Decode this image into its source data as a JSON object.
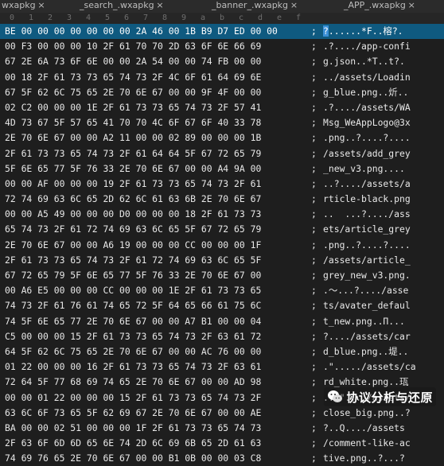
{
  "tabs": [
    {
      "label": "wxapkg",
      "close": "×"
    },
    {
      "label": "_search_.wxapkg",
      "close": "×"
    },
    {
      "label": "_banner_.wxapkg",
      "close": "×"
    },
    {
      "label": "_APP_.wxapkg",
      "close": "×"
    }
  ],
  "column_header": [
    "0",
    "1",
    "2",
    "3",
    "4",
    "5",
    "6",
    "7",
    "8",
    "9",
    "a",
    "b",
    "c",
    "d",
    "e",
    "f"
  ],
  "rows": [
    {
      "hex": "BE 00 00 00 00 00 00 00 2A 46 00 1B B9 D7 ED 00 00",
      "sep": ";",
      "text_caret": "?",
      "text_rest": "......*F..榕?."
    },
    {
      "hex": "00 F3 00 00 00 10 2F 61 70 70 2D 63 6F 6E 66 69",
      "sep": ";",
      "text": ".?..../app-confi"
    },
    {
      "hex": "67 2E 6A 73 6F 6E 00 00 2A 54 00 00 74 FB 00 00",
      "sep": ";",
      "text": "g.json..*T..t?."
    },
    {
      "hex": "00 18 2F 61 73 73 65 74 73 2F 4C 6F 61 64 69 6E",
      "sep": ";",
      "text": "../assets/Loadin"
    },
    {
      "hex": "67 5F 62 6C 75 65 2E 70 6E 67 00 00 9F 4F 00 00",
      "sep": ";",
      "text": "g_blue.png..炘.."
    },
    {
      "hex": "02 C2 00 00 00 1E 2F 61 73 73 65 74 73 2F 57 41",
      "sep": ";",
      "text": ".?..../assets/WA"
    },
    {
      "hex": "4D 73 67 5F 57 65 41 70 70 4C 6F 67 6F 40 33 78",
      "sep": ";",
      "text": "Msg_WeAppLogo@3x"
    },
    {
      "hex": "2E 70 6E 67 00 00 A2 11 00 00 02 89 00 00 00 1B",
      "sep": ";",
      "text": ".png..?....?...."
    },
    {
      "hex": "2F 61 73 73 65 74 73 2F 61 64 64 5F 67 72 65 79",
      "sep": ";",
      "text": "/assets/add_grey"
    },
    {
      "hex": "5F 6E 65 77 5F 76 33 2E 70 6E 67 00 00 A4 9A 00",
      "sep": ";",
      "text": "_new_v3.png...."
    },
    {
      "hex": "00 00 AF 00 00 00 19 2F 61 73 73 65 74 73 2F 61",
      "sep": ";",
      "text": "..?..../assets/a"
    },
    {
      "hex": "72 74 69 63 6C 65 2D 62 6C 61 63 6B 2E 70 6E 67",
      "sep": ";",
      "text": "rticle-black.png"
    },
    {
      "hex": "00 00 A5 49 00 00 00 D0 00 00 00 18 2F 61 73 73",
      "sep": ";",
      "text": "..  ...?..../ass"
    },
    {
      "hex": "65 74 73 2F 61 72 74 69 63 6C 65 5F 67 72 65 79",
      "sep": ";",
      "text": "ets/article_grey"
    },
    {
      "hex": "2E 70 6E 67 00 00 A6 19 00 00 00 CC 00 00 00 1F",
      "sep": ";",
      "text": ".png..?....?...."
    },
    {
      "hex": "2F 61 73 73 65 74 73 2F 61 72 74 69 63 6C 65 5F",
      "sep": ";",
      "text": "/assets/article_"
    },
    {
      "hex": "67 72 65 79 5F 6E 65 77 5F 76 33 2E 70 6E 67 00",
      "sep": ";",
      "text": "grey_new_v3.png."
    },
    {
      "hex": "00 A6 E5 00 00 00 CC 00 00 00 1E 2F 61 73 73 65",
      "sep": ";",
      "text": ".〜...?..../asse"
    },
    {
      "hex": "74 73 2F 61 76 61 74 65 72 5F 64 65 66 61 75 6C",
      "sep": ";",
      "text": "ts/avater_defaul"
    },
    {
      "hex": "74 5F 6E 65 77 2E 70 6E 67 00 00 A7 B1 00 00 04",
      "sep": ";",
      "text": "t_new.png..Π..."
    },
    {
      "hex": "C5 00 00 00 15 2F 61 73 73 65 74 73 2F 63 61 72",
      "sep": ";",
      "text": "?..../assets/car"
    },
    {
      "hex": "64 5F 62 6C 75 65 2E 70 6E 67 00 00 AC 76 00 00",
      "sep": ";",
      "text": "d_blue.png..堤.."
    },
    {
      "hex": "01 22 00 00 00 16 2F 61 73 73 65 74 73 2F 63 61",
      "sep": ";",
      "text": ".\"...../assets/ca"
    },
    {
      "hex": "72 64 5F 77 68 69 74 65 2E 70 6E 67 00 00 AD 98",
      "sep": ";",
      "text": "rd_white.png..珁"
    },
    {
      "hex": "00 00 01 22 00 00 00 15 2F 61 73 73 65 74 73 2F",
      "sep": ";",
      "text": "...\"..../assets/"
    },
    {
      "hex": "63 6C 6F 73 65 5F 62 69 67 2E 70 6E 67 00 00 AE",
      "sep": ";",
      "text": "close_big.png..?"
    },
    {
      "hex": "BA 00 00 02 51 00 00 00 1F 2F 61 73 73 65 74 73",
      "sep": ";",
      "text": "?..Q..../assets"
    },
    {
      "hex": "2F 63 6F 6D 6D 65 6E 74 2D 6C 69 6B 65 2D 61 63",
      "sep": ";",
      "text": "/comment-like-ac"
    },
    {
      "hex": "74 69 76 65 2E 70 6E 67 00 00 B1 0B 00 00 03 C8",
      "sep": ";",
      "text": "tive.png..?...?"
    }
  ],
  "watermark": {
    "text": "协议分析与还原",
    "icon": "wechat-icon"
  },
  "colors": {
    "background": "#1e1e1e",
    "selection": "#0f5a80",
    "caret": "#3a8fd6",
    "text": "#e8e8e8"
  }
}
